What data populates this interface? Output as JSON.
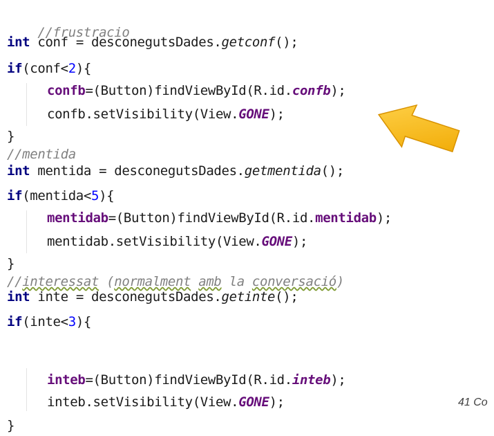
{
  "colors": {
    "background": "#ffffff",
    "comment": "#808080",
    "keyword": "#000080",
    "number": "#0000ff",
    "field": "#660e7a",
    "arrow": "#f5b400"
  },
  "code": {
    "l1": {
      "comment": "//frustracio"
    },
    "l2": {
      "kw": "int",
      "rest": " conf = desconegutsDades.",
      "method": "getconf",
      "tail": "();"
    },
    "l3": {
      "kw": "if",
      "a": "(conf<",
      "num": "2",
      "b": "){"
    },
    "l4": {
      "var": "confb",
      "a": "=(Button)findViewById(R.id.",
      "field": "confb",
      "b": ");"
    },
    "l5": {
      "a": "confb.setVisibility(View.",
      "static": "GONE",
      "b": ");"
    },
    "l6": {
      "brace": "}"
    },
    "l7": {
      "comment": "//mentida"
    },
    "l8": {
      "kw": "int",
      "rest": " mentida = desconegutsDades.",
      "method": "getmentida",
      "tail": "();"
    },
    "l9": {
      "kw": "if",
      "a": "(mentida<",
      "num": "5",
      "b": "){"
    },
    "l10": {
      "var": "mentidab",
      "a": "=(Button)findViewById(R.id.",
      "field": "mentidab",
      "b": ");"
    },
    "l11": {
      "a": "mentidab.setVisibility(View.",
      "static": "GONE",
      "b": ");"
    },
    "l12": {
      "brace": "}"
    },
    "l13": {
      "c1": "//",
      "w1": "interessat",
      "c2": " (",
      "w2": "normalment",
      "c3": " ",
      "w3": "amb",
      "c4": " la ",
      "w4": "conversació",
      "c5": ")"
    },
    "l14": {
      "kw": "int",
      "rest": " inte = desconegutsDades.",
      "method": "getinte",
      "tail": "();"
    },
    "l15": {
      "kw": "if",
      "a": "(inte<",
      "num": "3",
      "b": "){"
    },
    "l16": {
      "var": "inteb",
      "a": "=(Button)findViewById(R.id.",
      "field": "inteb",
      "b": ");"
    },
    "l17": {
      "a": "inteb.setVisibility(View.",
      "static": "GONE",
      "b": ");"
    },
    "l18": {
      "brace": "}"
    }
  },
  "page_note": "41 Co"
}
